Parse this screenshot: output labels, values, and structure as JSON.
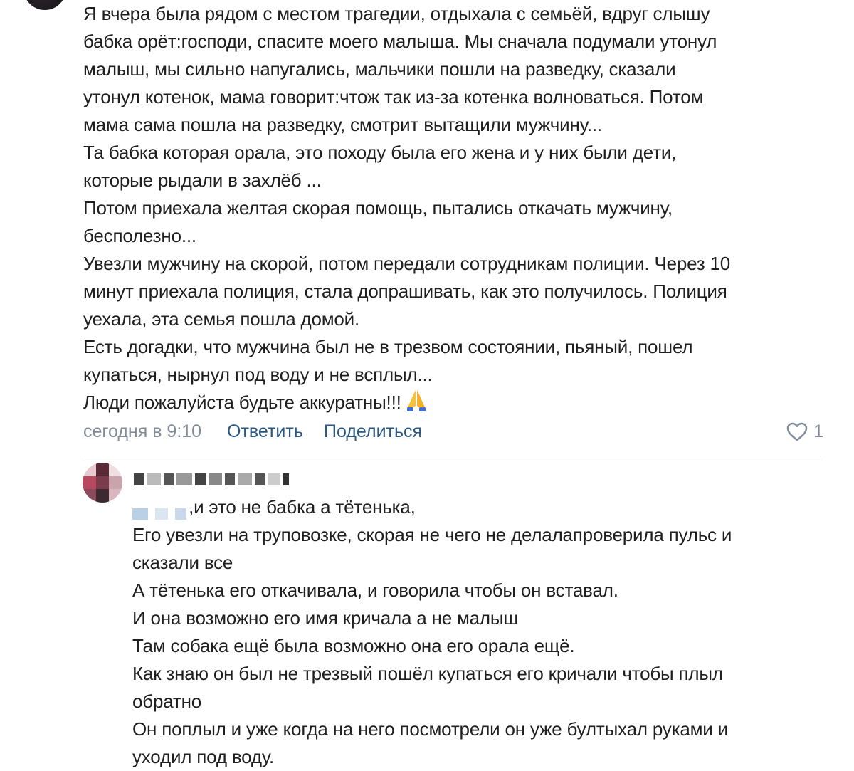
{
  "comment": {
    "lines": [
      "Я вчера была рядом с местом трагедии, отдыхала с семьёй, вдруг слышу",
      "бабка орёт:господи, спасите моего малыша. Мы сначала подумали утонул",
      "малыш, мы сильно напугались, мальчики пошли на разведку, сказали",
      "утонул котенок, мама говорит:чтож так из-за котенка волноваться. Потом",
      "мама сама пошла на разведку, смотрит вытащили мужчину...",
      "Та бабка которая орала, это походу была его жена и у них были дети,",
      "которые рыдали в захлёб ...",
      "Потом приехала желтая скорая помощь, пытались откачать мужчину,",
      "бесполезно...",
      "Увезли мужчину на скорой, потом передали сотрудникам полиции. Через 10",
      "минут приехала полиция, стала допрашивать, как это получилось. Полиция",
      "уехала, эта семья пошла домой.",
      "Есть догадки, что мужчина был не в трезвом состоянии, пьяный, пошел",
      "купаться, нырнул под воду и не всплыл...",
      "Люди пожалуйста будьте аккуратны!!!"
    ],
    "emoji": "folded-hands-emoji",
    "time": "сегодня в 9:10",
    "reply_label": "Ответить",
    "share_label": "Поделиться",
    "likes": "1"
  },
  "reply": {
    "first_line_text": ",и это не бабка а тётенька,",
    "lines": [
      "Его увезли на труповозке, скорая не чего не делалапроверила пульс и",
      "сказали все",
      "А тётенька его откачивала, и говорила чтобы он вставал.",
      "И она возможно его имя кричала а не малыш",
      "Там собака ещё была возможно она его орала ещё.",
      "Как знаю он был не трезвый пошёл купаться его кричали чтобы плыл",
      "обратно",
      "Он поплыл и уже когда на него посмотрели он уже бултыхал руками и",
      "уходил под воду."
    ]
  },
  "colors": {
    "text": "#1f1f1f",
    "link": "#2a5885",
    "meta": "#818c99",
    "divider": "#e7e8ec"
  }
}
